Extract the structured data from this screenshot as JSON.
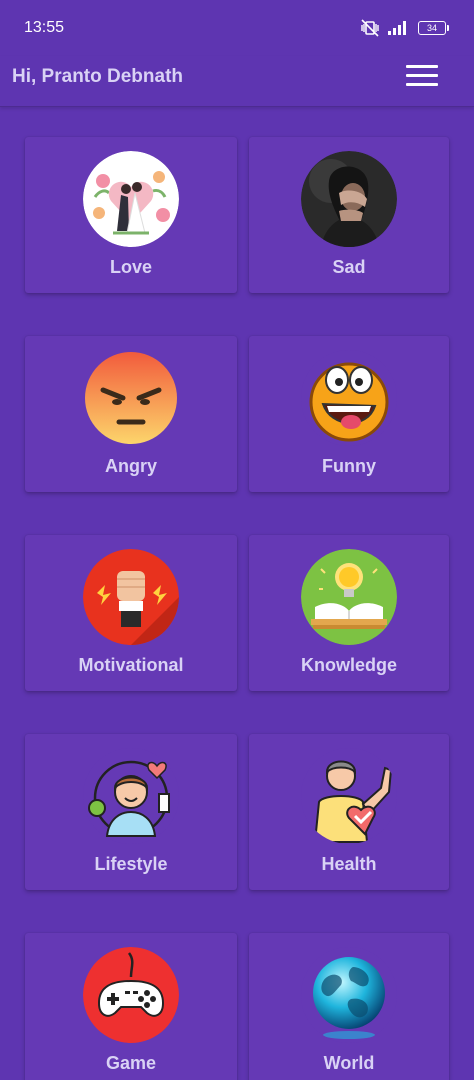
{
  "status_bar": {
    "time": "13:55",
    "battery": "34"
  },
  "header": {
    "greeting": "Hi, Pranto Debnath"
  },
  "categories": [
    {
      "label": "Love",
      "icon": "couple-hearts-icon"
    },
    {
      "label": "Sad",
      "icon": "sad-person-icon"
    },
    {
      "label": "Angry",
      "icon": "angry-face-icon"
    },
    {
      "label": "Funny",
      "icon": "funny-face-icon"
    },
    {
      "label": "Motivational",
      "icon": "raised-fist-icon"
    },
    {
      "label": "Knowledge",
      "icon": "book-bulb-icon"
    },
    {
      "label": "Lifestyle",
      "icon": "lifestyle-person-icon"
    },
    {
      "label": "Health",
      "icon": "strong-man-heart-icon"
    },
    {
      "label": "Game",
      "icon": "gamepad-icon"
    },
    {
      "label": "World",
      "icon": "globe-icon"
    }
  ],
  "colors": {
    "background": "#5e35b1",
    "card": "#6539b5",
    "label": "#d9d2f5"
  }
}
